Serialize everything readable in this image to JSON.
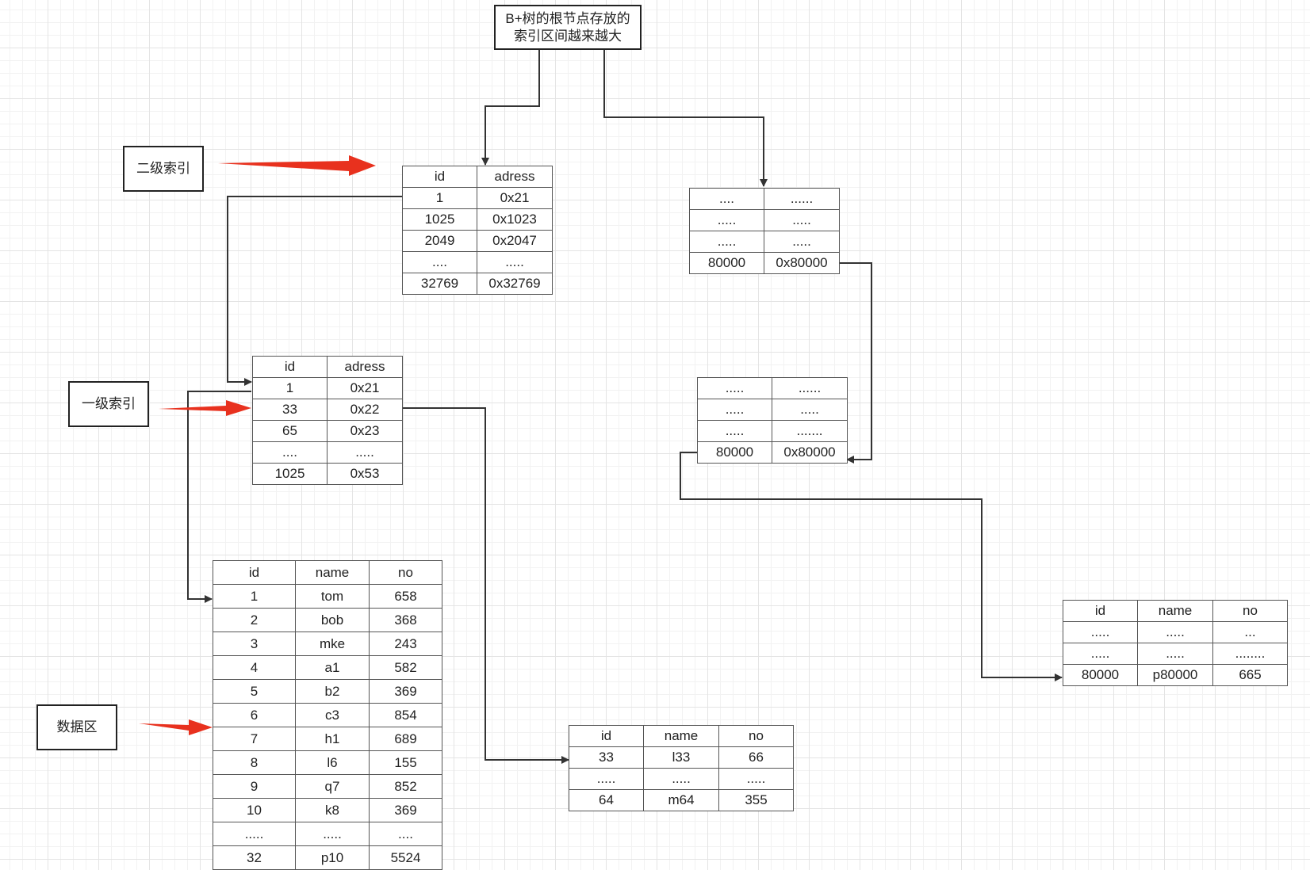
{
  "title": [
    "B+树的根节点存放的",
    "索引区间越来越大"
  ],
  "labels": {
    "secondary_index": "二级索引",
    "primary_index": "一级索引",
    "data_area": "数据区"
  },
  "colors": {
    "arrow_red": "#e8311e",
    "line": "#333333"
  },
  "tables": {
    "secondary_index_left": {
      "headers": [
        "id",
        "adress"
      ],
      "rows": [
        [
          "1",
          "0x21"
        ],
        [
          "1025",
          "0x1023"
        ],
        [
          "2049",
          "0x2047"
        ],
        [
          "....",
          "....."
        ],
        [
          "32769",
          "0x32769"
        ]
      ]
    },
    "secondary_index_right": {
      "rows": [
        [
          "....",
          "......"
        ],
        [
          ".....",
          "....."
        ],
        [
          ".....",
          "....."
        ],
        [
          "80000",
          "0x80000"
        ]
      ]
    },
    "primary_index_left": {
      "headers": [
        "id",
        "adress"
      ],
      "rows": [
        [
          "1",
          "0x21"
        ],
        [
          "33",
          "0x22"
        ],
        [
          "65",
          "0x23"
        ],
        [
          "....",
          "....."
        ],
        [
          "1025",
          "0x53"
        ]
      ]
    },
    "primary_index_right": {
      "rows": [
        [
          ".....",
          "......"
        ],
        [
          ".....",
          "....."
        ],
        [
          ".....",
          "......."
        ],
        [
          "80000",
          "0x80000"
        ]
      ]
    },
    "data_left": {
      "headers": [
        "id",
        "name",
        "no"
      ],
      "rows": [
        [
          "1",
          "tom",
          "658"
        ],
        [
          "2",
          "bob",
          "368"
        ],
        [
          "3",
          "mke",
          "243"
        ],
        [
          "4",
          "a1",
          "582"
        ],
        [
          "5",
          "b2",
          "369"
        ],
        [
          "6",
          "c3",
          "854"
        ],
        [
          "7",
          "h1",
          "689"
        ],
        [
          "8",
          "l6",
          "155"
        ],
        [
          "9",
          "q7",
          "852"
        ],
        [
          "10",
          "k8",
          "369"
        ],
        [
          ".....",
          ".....",
          "...."
        ],
        [
          "32",
          "p10",
          "5524"
        ]
      ]
    },
    "data_middle": {
      "headers": [
        "id",
        "name",
        "no"
      ],
      "rows": [
        [
          "33",
          "l33",
          "66"
        ],
        [
          ".....",
          ".....",
          "....."
        ],
        [
          "64",
          "m64",
          "355"
        ]
      ]
    },
    "data_right": {
      "headers": [
        "id",
        "name",
        "no"
      ],
      "rows": [
        [
          ".....",
          ".....",
          "..."
        ],
        [
          ".....",
          ".....",
          "........"
        ],
        [
          "80000",
          "p80000",
          "665"
        ]
      ]
    }
  }
}
